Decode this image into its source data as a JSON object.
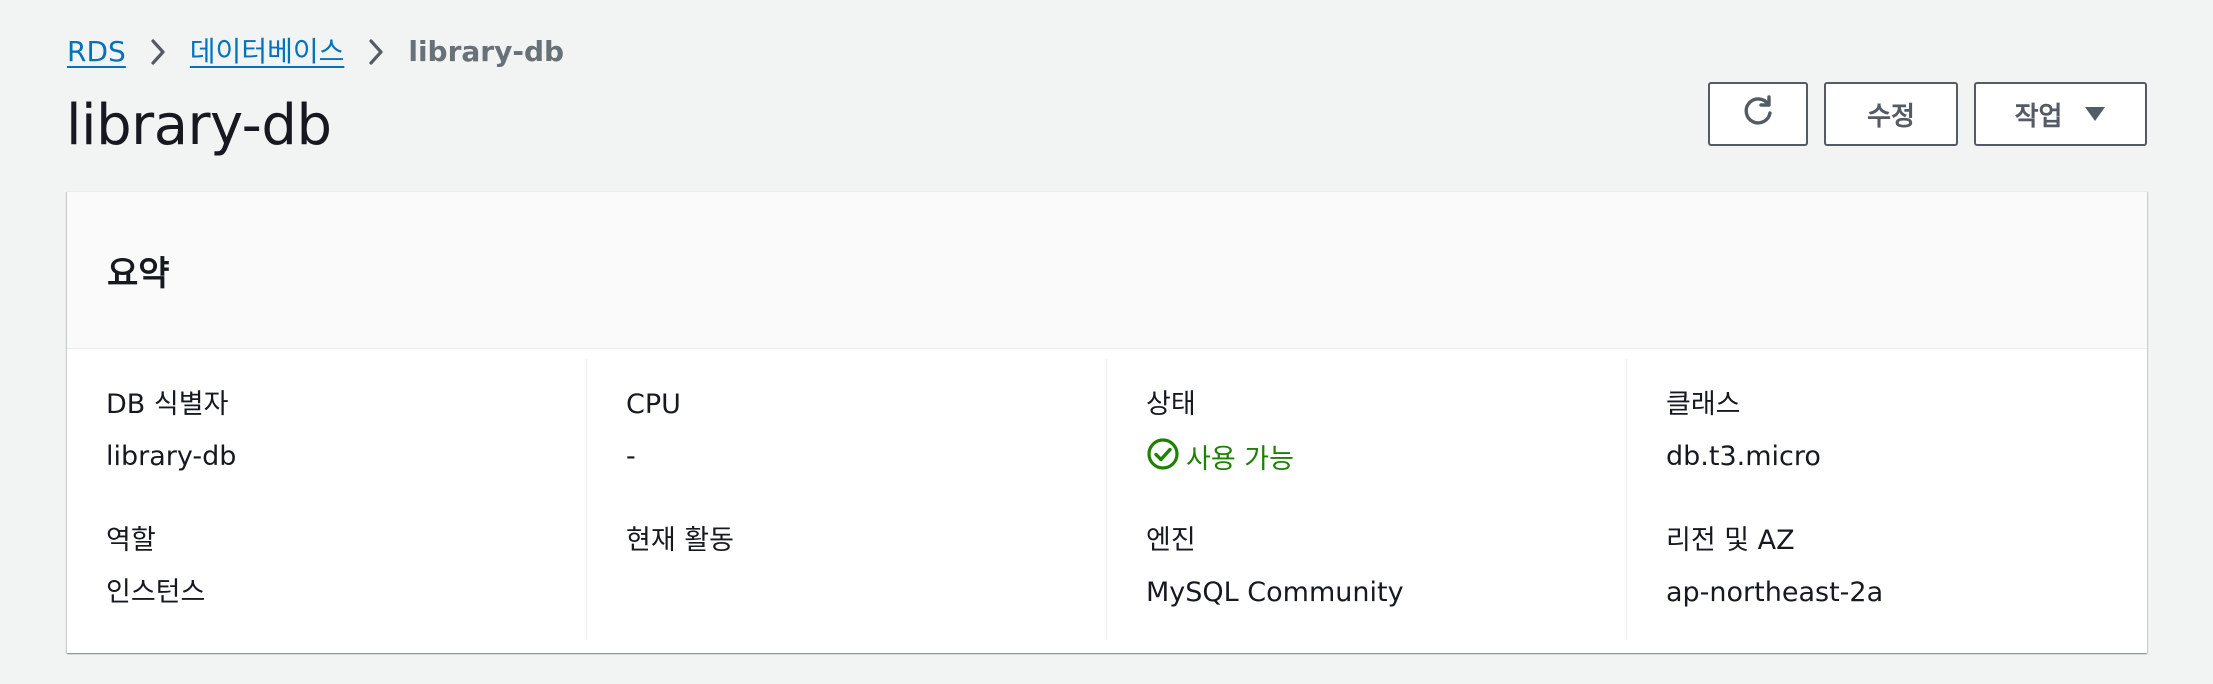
{
  "breadcrumb": {
    "items": [
      {
        "label": "RDS"
      },
      {
        "label": "데이터베이스"
      },
      {
        "label": "library-db"
      }
    ]
  },
  "page": {
    "title": "library-db"
  },
  "header_actions": {
    "refresh_icon": "refresh-icon",
    "modify_label": "수정",
    "actions_label": "작업",
    "actions_caret_icon": "caret-down-icon"
  },
  "summary": {
    "title": "요약",
    "columns": [
      {
        "fields": [
          {
            "label": "DB 식별자",
            "value": "library-db"
          },
          {
            "label": "역할",
            "value": "인스턴스"
          }
        ]
      },
      {
        "fields": [
          {
            "label": "CPU",
            "value": "-"
          },
          {
            "label": "현재 활동",
            "value": ""
          }
        ]
      },
      {
        "fields": [
          {
            "label": "상태",
            "value": "사용 가능",
            "status": "available",
            "status_icon": "check-circle-icon",
            "status_color": "#1d8102"
          },
          {
            "label": "엔진",
            "value": "MySQL Community"
          }
        ]
      },
      {
        "fields": [
          {
            "label": "클래스",
            "value": "db.t3.micro"
          },
          {
            "label": "리전 및 AZ",
            "value": "ap-northeast-2a"
          }
        ]
      }
    ]
  },
  "colors": {
    "link": "#0073bb",
    "background": "#f2f3f3",
    "success": "#1d8102",
    "button_border": "#545b64"
  }
}
